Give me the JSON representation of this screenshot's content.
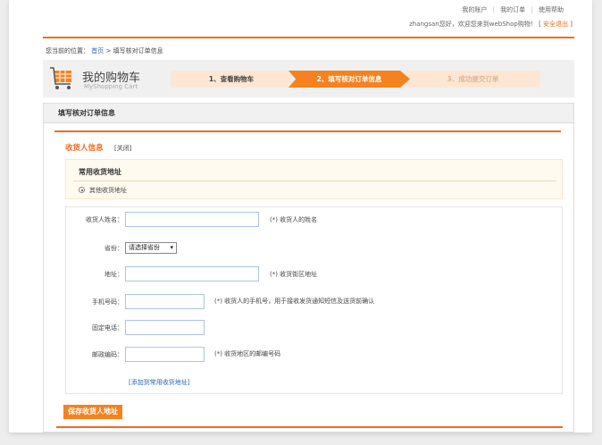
{
  "header": {
    "links": [
      "我的账户",
      "我的订单",
      "使用帮助"
    ],
    "welcome_text": "zhangsan您好，欢迎您来到webShop购物！",
    "logout_label": "安全退出",
    "bracket_left": "[",
    "bracket_right": "]"
  },
  "breadcrumb": {
    "prefix": "您当前的位置：",
    "home": "首页",
    "separator": ">",
    "current": "填写核对订单信息"
  },
  "cart": {
    "title": "我的购物车",
    "subtitle": "MyShopping Cart",
    "steps": [
      "1、查看购物车",
      "2、填写核对订单信息",
      "3、成功提交订单"
    ]
  },
  "panel": {
    "title": "填写核对订单信息",
    "receiver_title": "收货人信息",
    "close_label": "[关闭]",
    "common_title": "常用收货地址",
    "other_address": "其他收货地址"
  },
  "form": {
    "name_label": "收货人姓名：",
    "name_hint": "(*) 收货人的姓名",
    "province_label": "省份：",
    "province_select": "请选择省份",
    "address_label": "地址：",
    "address_hint": "(*) 收货街区地址",
    "mobile_label": "手机号码：",
    "mobile_hint": "(*) 收货人的手机号，用于接收发货通知短信及送货前确认",
    "phone_label": "固定电话：",
    "zip_label": "邮政编码：",
    "zip_hint": "(*) 收货地区的邮编号码",
    "add_link": "[添加到常用收货地址]",
    "save_button": "保存收货人地址"
  },
  "colors": {
    "accent": "#f26b1d",
    "link": "#2d64b3",
    "step_active": "#f58220",
    "step_inactive": "#fde7d4"
  }
}
